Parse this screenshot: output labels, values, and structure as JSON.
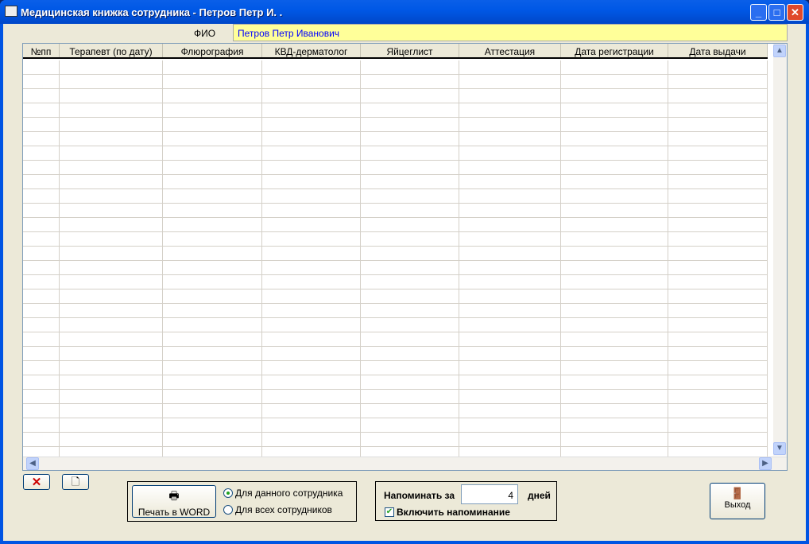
{
  "window": {
    "title": "Медицинская книжка сотрудника -  Петров Петр И. ."
  },
  "fio": {
    "label": "ФИО",
    "value": "Петров Петр Иванович"
  },
  "table": {
    "columns": [
      "№пп",
      "Терапевт (по дату)",
      "Флюрография",
      "КВД-дерматолог",
      "Яйцеглист",
      "Аттестация",
      "Дата регистрации",
      "Дата выдачи"
    ]
  },
  "print": {
    "button": "Печать в WORD",
    "options": [
      "Для данного сотрудника",
      "Для всех сотрудников"
    ],
    "selected": 0
  },
  "reminder": {
    "label": "Напоминать за",
    "days_value": "4",
    "days_label": "дней",
    "enable_label": "Включить напоминание",
    "enabled": true
  },
  "exit": {
    "label": "Выход"
  }
}
